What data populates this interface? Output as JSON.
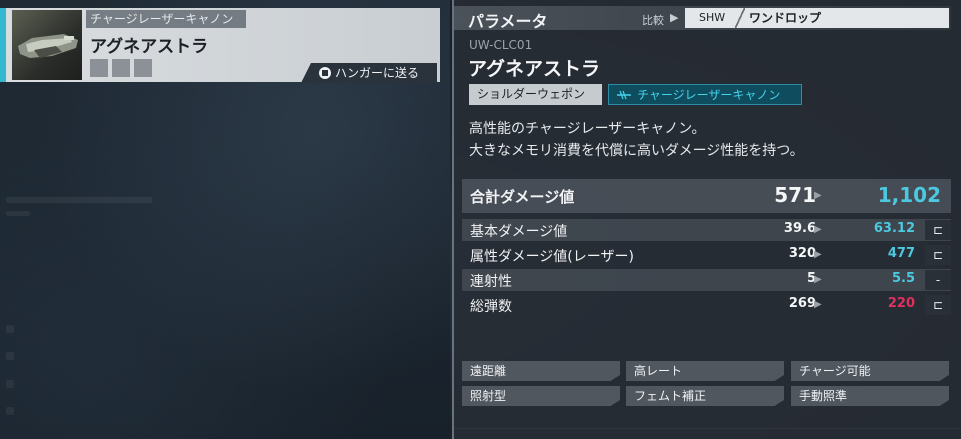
{
  "weapon_card": {
    "type_label": "チャージレーザーキャノン",
    "name": "アグネアストラ",
    "send_button_label": "ハンガーに送る",
    "accent_color": "#34b8cf"
  },
  "panel": {
    "title": "パラメータ",
    "compare_label": "比較",
    "compare_code": "SHW",
    "compare_name": "ワンドロップ",
    "model_code": "UW-CLC01",
    "unit_name": "アグネアストラ",
    "tags": {
      "category": "ショルダーウェポン",
      "type": "チャージレーザーキャノン",
      "type_icon": "laser-icon"
    },
    "description": [
      "高性能のチャージレーザーキャノン。",
      "大きなメモリ消費を代償に高いダメージ性能を持つ。"
    ]
  },
  "stats": {
    "total": {
      "label": "合計ダメージ値",
      "current": "571",
      "new": "1,102"
    },
    "rows": [
      {
        "label": "基本ダメージ値",
        "current": "39.6",
        "new": "63.12",
        "indicator": "⊏",
        "new_status": "better"
      },
      {
        "label": "属性ダメージ値(レーザー)",
        "current": "320",
        "new": "477",
        "indicator": "⊏",
        "new_status": "better"
      },
      {
        "label": "連射性",
        "current": "5",
        "new": "5.5",
        "indicator": "-",
        "new_status": "better"
      },
      {
        "label": "総弾数",
        "current": "269",
        "new": "220",
        "indicator": "⊏",
        "new_status": "worse"
      }
    ]
  },
  "features": [
    "遠距離",
    "高レート",
    "チャージ可能",
    "照射型",
    "フェムト補正",
    "手動照準"
  ],
  "colors": {
    "better": "#4cc9e0",
    "worse": "#e0305c",
    "panel_bg": "#2a3038"
  }
}
